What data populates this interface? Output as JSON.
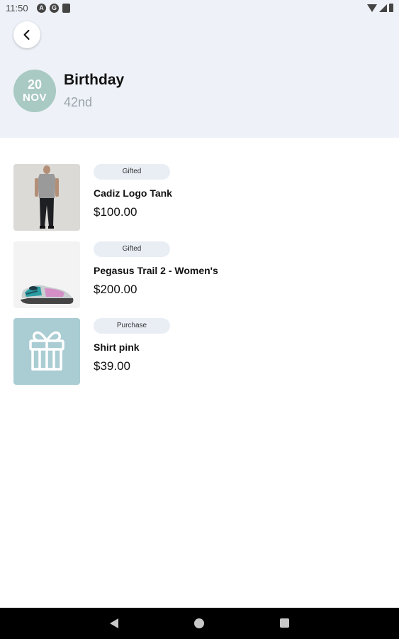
{
  "status_bar": {
    "time": "11:50"
  },
  "event": {
    "day": "20",
    "month": "NOV",
    "title": "Birthday",
    "subtitle": "42nd"
  },
  "items": [
    {
      "tag": "Gifted",
      "name": "Cadiz Logo Tank",
      "price": "$100.00",
      "image": "tank-top-photo"
    },
    {
      "tag": "Gifted",
      "name": "Pegasus Trail 2 - Women's",
      "price": "$200.00",
      "image": "sneaker-photo"
    },
    {
      "tag": "Purchase",
      "name": "Shirt pink",
      "price": "$39.00",
      "image": "gift-icon"
    }
  ],
  "colors": {
    "header_bg": "#eef2f8",
    "date_badge": "#a9c9c3",
    "gift_tile": "#a9cdd3",
    "tag_bg": "#e9eef5"
  }
}
